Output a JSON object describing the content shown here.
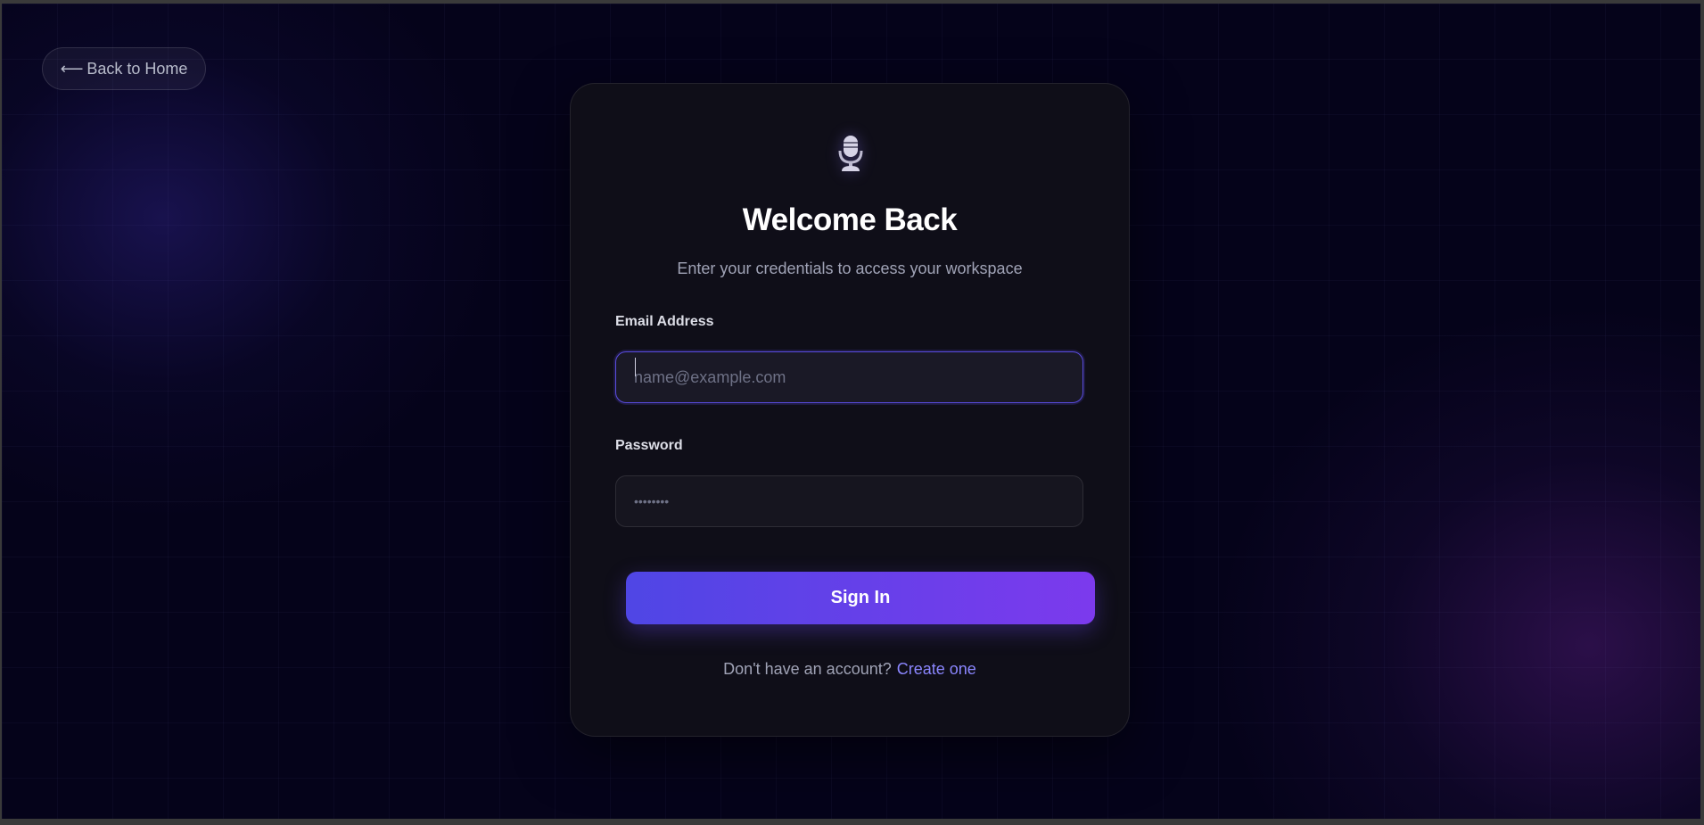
{
  "nav": {
    "back_arrow": "⟵",
    "back_label": "Back to Home"
  },
  "card": {
    "logo_icon": "microphone-icon",
    "title": "Welcome Back",
    "subtitle": "Enter your credentials to access your workspace"
  },
  "form": {
    "email_label": "Email Address",
    "email_value": "",
    "email_placeholder": "name@example.com",
    "password_label": "Password",
    "password_value": "",
    "password_placeholder": "••••••••",
    "submit_label": "Sign In"
  },
  "footer": {
    "prompt": "Don't have an account?",
    "link_label": "Create one"
  },
  "colors": {
    "background": "#05031a",
    "card": "#0f0e18",
    "accent_start": "#4f46e5",
    "accent_end": "#7c3aed",
    "link": "#8b86ff"
  }
}
